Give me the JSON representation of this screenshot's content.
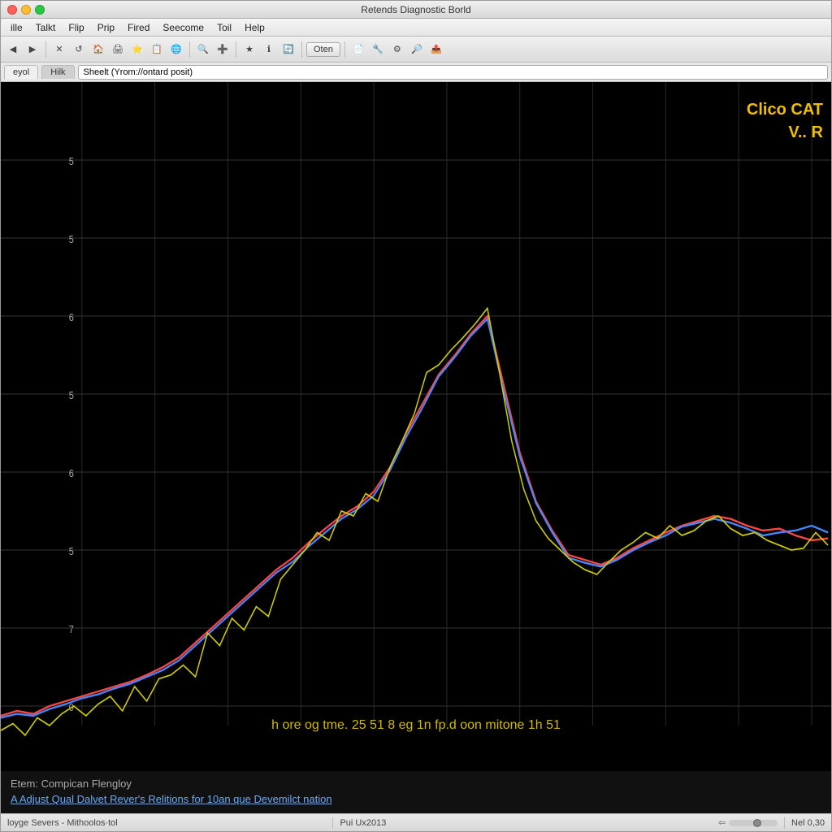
{
  "window": {
    "title": "Retends Diagnostic Borld"
  },
  "menu": {
    "items": [
      "ille",
      "Talkt",
      "Flip",
      "Prip",
      "Fired",
      "Seecome",
      "Toil",
      "Help"
    ]
  },
  "toolbar": {
    "buttons": [
      "⏪",
      "▶",
      "⬛",
      "📄",
      "📋",
      "🔵",
      "⬛",
      "📊",
      "🌐",
      "🔍",
      "➕",
      "❤",
      "ℹ",
      "🔄"
    ],
    "open_label": "Oten"
  },
  "address": {
    "tab1": "eyol",
    "tab2": "Hilk",
    "url": "Sheelt (Yrom://ontard posit)"
  },
  "chart": {
    "label_top_right_line1": "Clico CAT",
    "label_top_right_line2": "V.. R",
    "x_axis_label": "h ore  og  tme.  25  51  8  eg  1n  fp.d  oon  mitone  1h  51",
    "bottom_line1": "Etem: Compican Flengloy",
    "bottom_line2": "A Adjust Qual Dalvet Rever's Relitions for 10an que Devemilct nation"
  },
  "status": {
    "left": "loyge Severs - Mithoolos·tol",
    "middle": "Pui Ux2013",
    "zoom_label": "Nel 0,30"
  },
  "colors": {
    "line_red": "#ff4444",
    "line_blue": "#4488ff",
    "line_yellow": "#dddd00",
    "grid": "#333333",
    "background": "#000000"
  }
}
